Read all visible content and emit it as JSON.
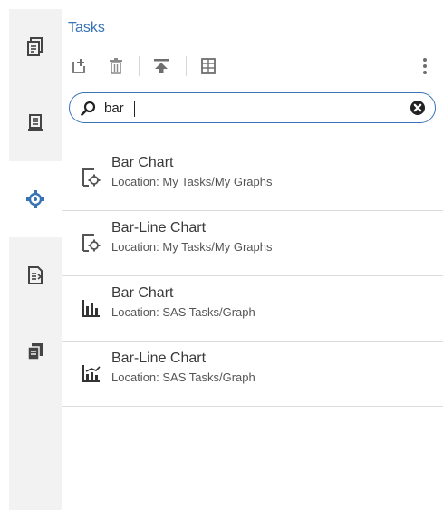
{
  "panel": {
    "title": "Tasks"
  },
  "toolbar": {
    "buttons": [
      "new-task-icon",
      "delete-icon",
      "upload-icon",
      "properties-icon",
      "more-vertical-icon"
    ]
  },
  "search": {
    "value": "bar",
    "placeholder": ""
  },
  "sidebar": {
    "items": [
      "server-files-icon",
      "libraries-icon",
      "tasks-icon",
      "snippets-icon",
      "file-shortcuts-icon"
    ],
    "active": "tasks-icon"
  },
  "results": [
    {
      "title": "Bar Chart",
      "location": "Location: My Tasks/My Graphs",
      "icon": "custom-task-icon"
    },
    {
      "title": "Bar-Line Chart",
      "location": "Location: My Tasks/My Graphs",
      "icon": "custom-task-icon"
    },
    {
      "title": "Bar Chart",
      "location": "Location: SAS Tasks/Graph",
      "icon": "bar-chart-icon"
    },
    {
      "title": "Bar-Line Chart",
      "location": "Location: SAS Tasks/Graph",
      "icon": "bar-line-chart-icon"
    }
  ],
  "colors": {
    "accent": "#3672b4",
    "icon": "#444444",
    "sidebar_bg": "#f2f2f2"
  }
}
